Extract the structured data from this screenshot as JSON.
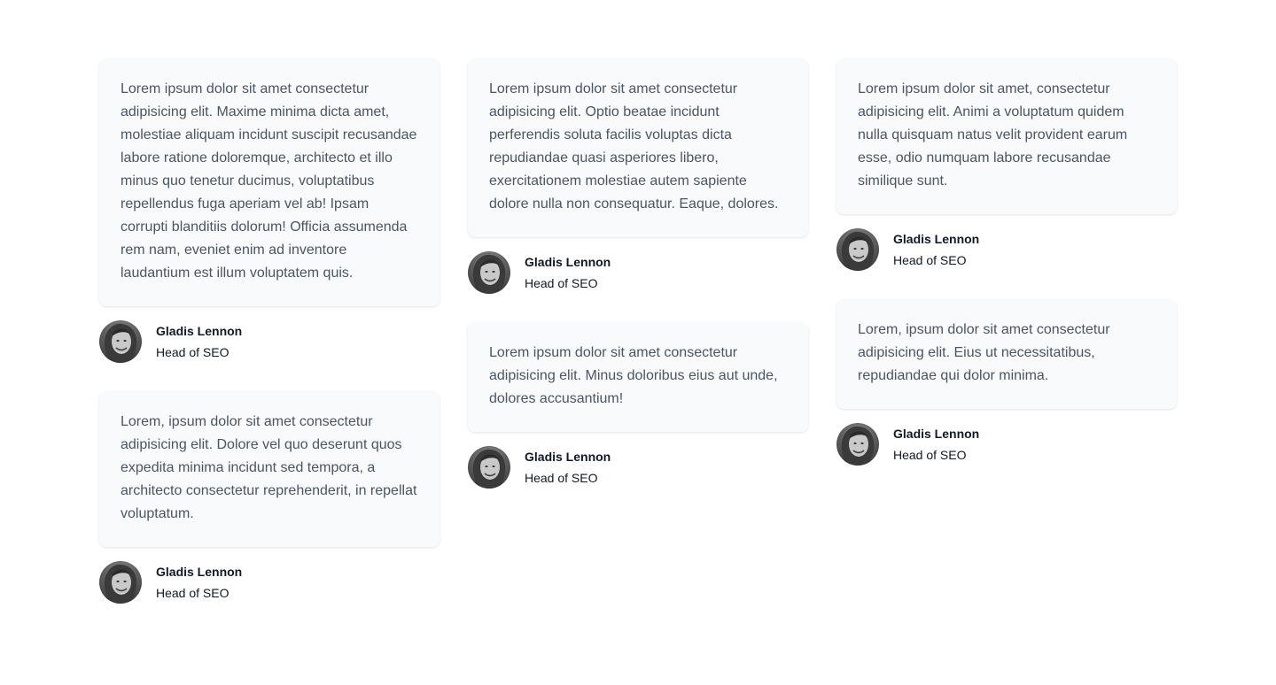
{
  "testimonials": [
    {
      "quote": "Lorem ipsum dolor sit amet consectetur adipisicing elit. Maxime minima dicta amet, molestiae aliquam incidunt suscipit recusandae labore ratione doloremque, architecto et illo minus quo tenetur ducimus, voluptatibus repellendus fuga aperiam vel ab! Ipsam corrupti blanditiis dolorum! Officia assumenda rem nam, eveniet enim ad inventore laudantium est illum voluptatem quis.",
      "name": "Gladis Lennon",
      "title": "Head of SEO"
    },
    {
      "quote": "Lorem, ipsum dolor sit amet consectetur adipisicing elit. Dolore vel quo deserunt quos expedita minima incidunt sed tempora, a architecto consectetur reprehenderit, in repellat voluptatum.",
      "name": "Gladis Lennon",
      "title": "Head of SEO"
    },
    {
      "quote": "Lorem ipsum dolor sit amet consectetur adipisicing elit. Optio beatae incidunt perferendis soluta facilis voluptas dicta repudiandae quasi asperiores libero, exercitationem molestiae autem sapiente dolore nulla non consequatur. Eaque, dolores.",
      "name": "Gladis Lennon",
      "title": "Head of SEO"
    },
    {
      "quote": "Lorem ipsum dolor sit amet consectetur adipisicing elit. Minus doloribus eius aut unde, dolores accusantium!",
      "name": "Gladis Lennon",
      "title": "Head of SEO"
    },
    {
      "quote": "Lorem ipsum dolor sit amet, consectetur adipisicing elit. Animi a voluptatum quidem nulla quisquam natus velit provident earum esse, odio numquam labore recusandae similique sunt.",
      "name": "Gladis Lennon",
      "title": "Head of SEO"
    },
    {
      "quote": "Lorem, ipsum dolor sit amet consectetur adipisicing elit. Eius ut necessitatibus, repudiandae qui dolor minima.",
      "name": "Gladis Lennon",
      "title": "Head of SEO"
    }
  ],
  "avatar_icon": "person-photo"
}
